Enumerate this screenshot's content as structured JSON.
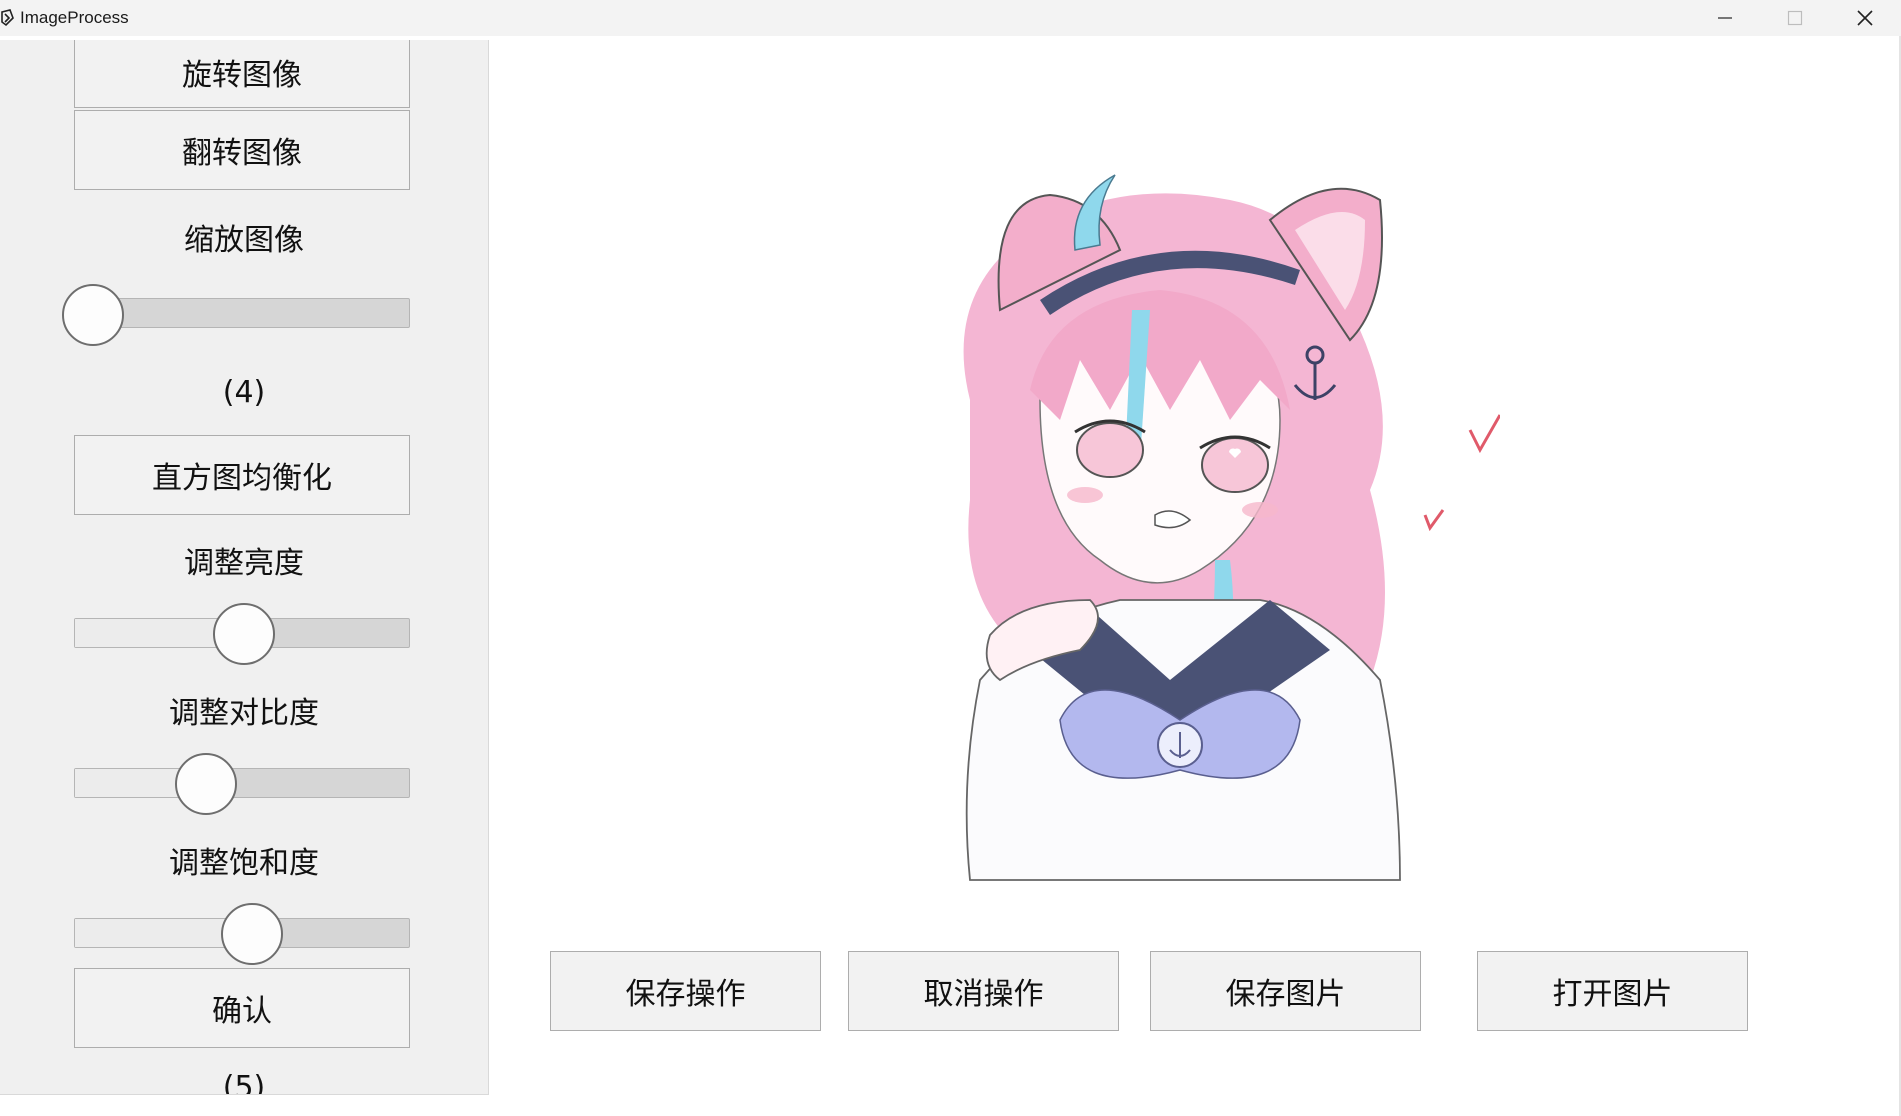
{
  "window": {
    "title": "ImageProcess"
  },
  "sidebar": {
    "rotate_label": "旋转图像",
    "flip_label": "翻转图像",
    "zoom_label": "缩放图像",
    "zoom_value": 0.0,
    "step4_text": "(4)",
    "histeq_label": "直方图均衡化",
    "brightness_label": "调整亮度",
    "brightness_value": 0.5,
    "contrast_label": "调整对比度",
    "contrast_value": 0.4,
    "saturation_label": "调整饱和度",
    "saturation_value": 0.5,
    "confirm_label": "确认",
    "step5_text": "(5)"
  },
  "actions": {
    "save_op": "保存操作",
    "cancel_op": "取消操作",
    "save_img": "保存图片",
    "open_img": "打开图片"
  },
  "colors": {
    "hair": "#f3b3d2",
    "hair_accent": "#8fd8ec",
    "ribbon": "#4a5275",
    "bow": "#b3b8ee"
  }
}
